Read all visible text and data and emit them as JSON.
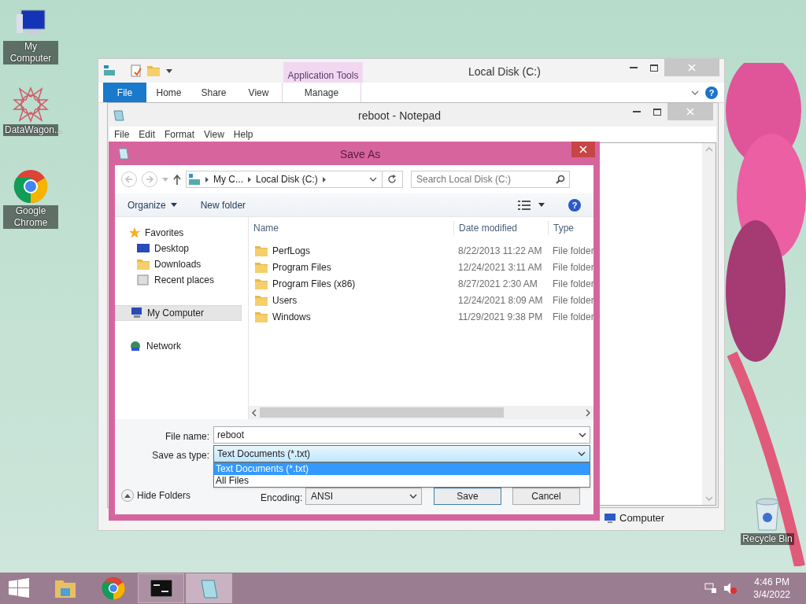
{
  "desktop_icons": [
    {
      "label": "My Computer",
      "kind": "computer"
    },
    {
      "label": "DataWagon...",
      "kind": "star"
    },
    {
      "label": "Google Chrome",
      "kind": "chrome"
    },
    {
      "label": "Recycle Bin",
      "kind": "recycle"
    }
  ],
  "explorer": {
    "title": "Local Disk (C:)",
    "context_group": "Application Tools",
    "ribbon_tabs": [
      {
        "label": "File",
        "kind": "file"
      },
      {
        "label": "Home",
        "kind": "normal"
      },
      {
        "label": "Share",
        "kind": "normal"
      },
      {
        "label": "View",
        "kind": "normal"
      },
      {
        "label": "Manage",
        "kind": "context"
      }
    ],
    "status_text": "Computer",
    "help_glyph": "?"
  },
  "notepad": {
    "title": "reboot - Notepad",
    "menu": [
      "File",
      "Edit",
      "Format",
      "View",
      "Help"
    ]
  },
  "save_as": {
    "title": "Save As",
    "breadcrumb": [
      "My C...",
      "Local Disk (C:)"
    ],
    "search": {
      "placeholder": "Search Local Disk (C:)"
    },
    "toolbar": [
      "Organize",
      "New folder"
    ],
    "help_glyph": "?",
    "nav": [
      {
        "label": "Favorites",
        "kind": "star",
        "selected": false,
        "children": [
          {
            "label": "Desktop",
            "kind": "desktop",
            "selected": false
          },
          {
            "label": "Downloads",
            "kind": "downloads",
            "selected": false
          },
          {
            "label": "Recent places",
            "kind": "recent",
            "selected": false
          }
        ]
      },
      {
        "label": "My Computer",
        "kind": "computer",
        "selected": true
      },
      {
        "label": "Network",
        "kind": "network",
        "selected": false
      }
    ],
    "columns": [
      "Name",
      "Date modified",
      "Type"
    ],
    "rows": [
      {
        "name": "PerfLogs",
        "date": "8/22/2013 11:22 AM",
        "type": "File folder"
      },
      {
        "name": "Program Files",
        "date": "12/24/2021 3:11 AM",
        "type": "File folder"
      },
      {
        "name": "Program Files (x86)",
        "date": "8/27/2021 2:30 AM",
        "type": "File folder"
      },
      {
        "name": "Users",
        "date": "12/24/2021 8:09 AM",
        "type": "File folder"
      },
      {
        "name": "Windows",
        "date": "11/29/2021 9:38 PM",
        "type": "File folder"
      }
    ],
    "file_name_label": "File name:",
    "file_name": "reboot",
    "type_label": "Save as type:",
    "save_type": "Text Documents (*.txt)",
    "type_options": [
      {
        "label": "Text Documents (*.txt)",
        "selected": true
      },
      {
        "label": "All Files",
        "selected": false
      }
    ],
    "hide_folders": "Hide Folders",
    "encoding_label": "Encoding:",
    "encoding": "ANSI",
    "buttons": [
      "Save",
      "Cancel"
    ]
  },
  "taskbar": {
    "apps": [
      {
        "kind": "explorer",
        "running": false,
        "selected": false
      },
      {
        "kind": "chrome",
        "running": false,
        "selected": false
      },
      {
        "kind": "cmd",
        "running": true,
        "selected": false
      },
      {
        "kind": "notepad",
        "running": true,
        "selected": true
      }
    ],
    "time": "4:46 PM",
    "date": "3/4/2022"
  }
}
